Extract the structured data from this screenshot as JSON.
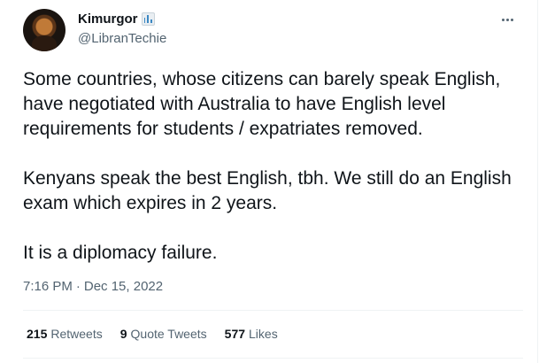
{
  "author": {
    "display_name": "Kimurgor",
    "badge_icon": "bar-chart-emoji",
    "handle": "@LibranTechie"
  },
  "tweet": {
    "paragraphs": [
      "Some countries, whose citizens can barely speak English, have negotiated with Australia to have English level requirements for students / expatriates removed.",
      "Kenyans speak the best English, tbh. We still do an English exam which expires in 2 years.",
      "It is a diplomacy failure."
    ],
    "time": "7:16 PM",
    "separator": "·",
    "date": "Dec 15, 2022"
  },
  "stats": {
    "retweets_count": "215",
    "retweets_label": "Retweets",
    "quotes_count": "9",
    "quotes_label": "Quote Tweets",
    "likes_count": "577",
    "likes_label": "Likes"
  },
  "colors": {
    "text": "#0f1419",
    "secondary": "#536471",
    "border": "#eff3f4"
  }
}
